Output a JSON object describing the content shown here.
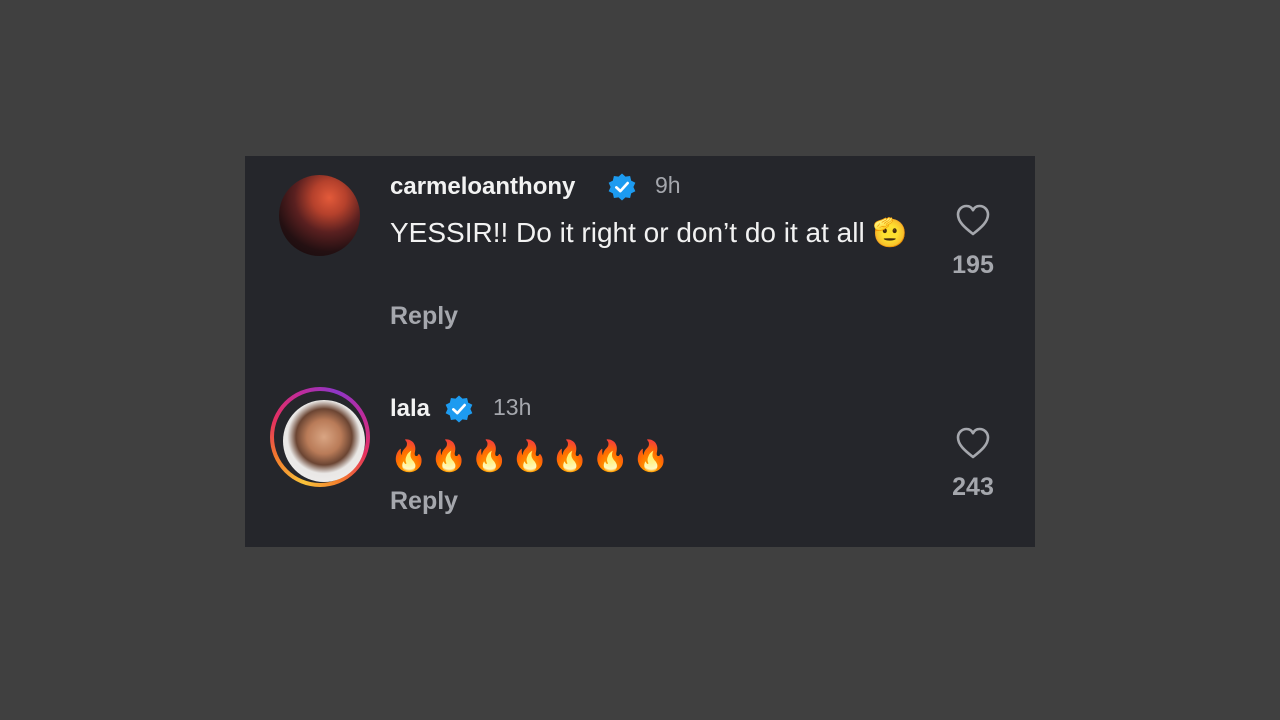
{
  "comments": [
    {
      "username": "carmeloanthony",
      "verified": true,
      "time": "9h",
      "text": "YESSIR!! Do it right or don’t do it at all 🫡",
      "reply_label": "Reply",
      "likes": "195",
      "avatar": "profile-photo"
    },
    {
      "username": "lala",
      "verified": true,
      "time": "13h",
      "text": "🔥🔥🔥🔥🔥🔥🔥",
      "reply_label": "Reply",
      "likes": "243",
      "avatar": "profile-photo-with-story-ring"
    }
  ],
  "colors": {
    "page_background": "#404040",
    "panel_background": "#25262b",
    "primary_text": "#f2f2f2",
    "secondary_text": "#a5a7ad",
    "verified_badge": "#1d9bf0"
  },
  "icons": {
    "verified": "verified-badge-icon",
    "like": "heart-outline-icon"
  }
}
